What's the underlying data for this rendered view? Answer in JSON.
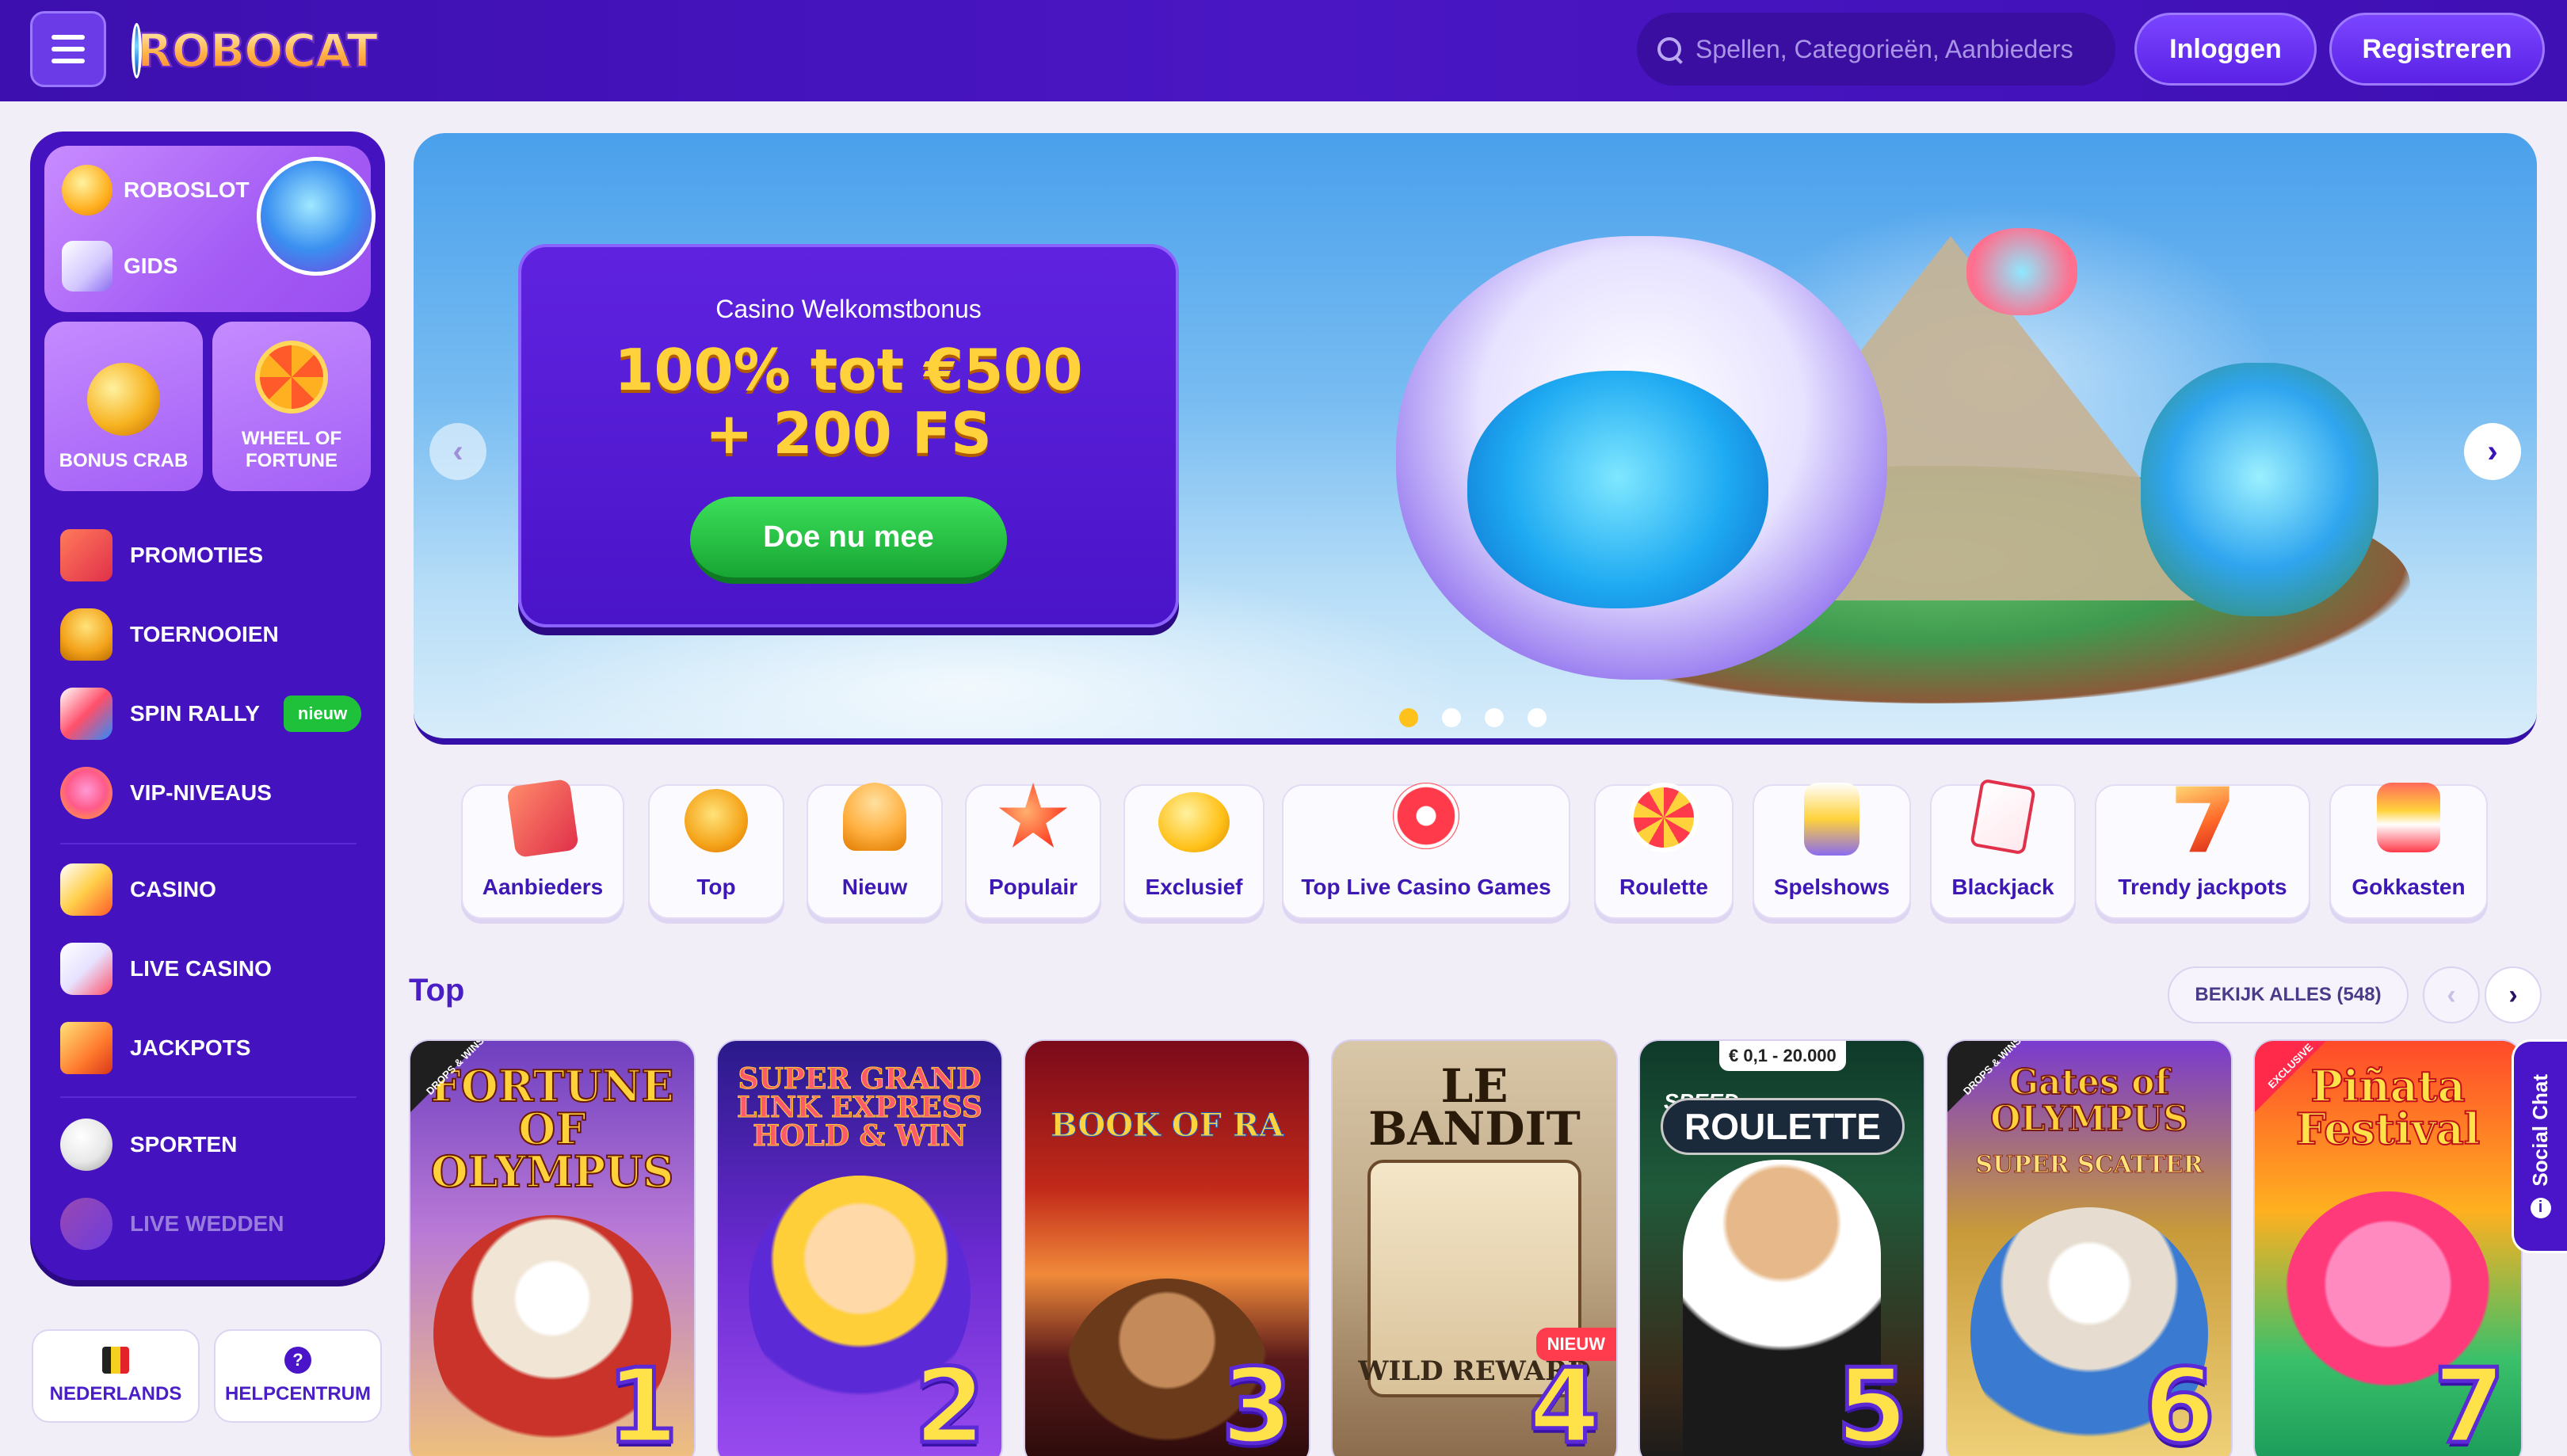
{
  "header": {
    "logo_text": "ROBOCAT",
    "search_placeholder": "Spellen, Categorieën, Aanbieders",
    "login_label": "Inloggen",
    "register_label": "Registreren"
  },
  "sidebar": {
    "roboslot_label": "ROBOSLOT",
    "guide_label": "GIDS",
    "tiles": [
      {
        "label": "BONUS CRAB"
      },
      {
        "label": "WHEEL OF FORTUNE"
      }
    ],
    "nav": [
      {
        "label": "PROMOTIES"
      },
      {
        "label": "TOERNOOIEN"
      },
      {
        "label": "SPIN RALLY",
        "badge": "nieuw"
      },
      {
        "label": "VIP-NIVEAUS"
      },
      {
        "label": "CASINO"
      },
      {
        "label": "LIVE CASINO"
      },
      {
        "label": "JACKPOTS"
      },
      {
        "label": "SPORTEN"
      },
      {
        "label": "LIVE WEDDEN"
      }
    ],
    "language_label": "NEDERLANDS",
    "help_label": "HELPCENTRUM"
  },
  "hero": {
    "subtitle": "Casino Welkomstbonus",
    "title_line1": "100% tot €500",
    "title_line2": "+ 200 FS",
    "cta_label": "Doe nu mee",
    "slide_count": 4,
    "active_slide": 1
  },
  "categories": [
    {
      "label": "Aanbieders",
      "icon": "cards-icon"
    },
    {
      "label": "Top",
      "icon": "medal-icon"
    },
    {
      "label": "Nieuw",
      "icon": "bell-icon"
    },
    {
      "label": "Populair",
      "icon": "star-icon"
    },
    {
      "label": "Exclusief",
      "icon": "gem-icon"
    },
    {
      "label": "Top Live Casino Games",
      "icon": "chip-icon"
    },
    {
      "label": "Roulette",
      "icon": "roulette-icon"
    },
    {
      "label": "Spelshows",
      "icon": "show-icon"
    },
    {
      "label": "Blackjack",
      "icon": "blackjack-icon"
    },
    {
      "label": "Trendy jackpots",
      "icon": "seven-icon"
    },
    {
      "label": "Gokkasten",
      "icon": "slot-icon"
    }
  ],
  "top_section": {
    "title": "Top",
    "see_all_label": "BEKIJK ALLES (548)",
    "games": [
      {
        "title": "FORTUNE OF OLYMPUS",
        "rank": "1",
        "badge": "DROPS & WINS"
      },
      {
        "title": "SUPER GRAND LINK EXPRESS HOLD & WIN",
        "rank": "2"
      },
      {
        "title": "BOOK OF RA",
        "rank": "3"
      },
      {
        "title": "LE BANDIT",
        "subtitle": "WILD REWARD",
        "rank": "4",
        "tag": "NIEUW"
      },
      {
        "title": "ROULETTE",
        "prefix": "SPEED",
        "price": "€ 0,1 - 20.000",
        "rank": "5"
      },
      {
        "title": "Gates of OLYMPUS",
        "subtitle": "SUPER SCATTER",
        "rank": "6",
        "badge": "DROPS & WINS"
      },
      {
        "title": "Piñata Festival",
        "rank": "7",
        "badge": "EXCLUSIVE"
      }
    ]
  },
  "social_chat_label": "Social Chat",
  "colors": {
    "brand_purple": "#4512c0",
    "accent_yellow": "#ffd23b",
    "cta_green": "#1fc13b"
  }
}
